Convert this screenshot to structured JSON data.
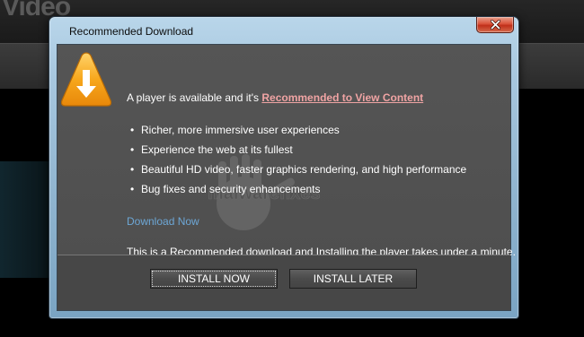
{
  "background": {
    "site_title": "Video"
  },
  "dialog": {
    "title": "Recommended Download",
    "headline_prefix": "A player is available and it's ",
    "headline_link": "Recommended to View Content",
    "features": [
      "Richer, more immersive user experiences",
      "Experience the web at its fullest",
      "Beautiful HD video, faster graphics rendering, and high performance",
      "Bug fixes and security enhancements"
    ],
    "download_link": "Download Now",
    "footnote": "This is a Recommended download and Installing the player takes under a minute.",
    "buttons": {
      "install_now": "INSTALL NOW",
      "install_later": "INSTALL LATER"
    },
    "watermark_text": "malwarefixes"
  },
  "icons": {
    "warning": "warning-download-icon",
    "close": "close-icon"
  },
  "colors": {
    "link": "#f0a4a4",
    "download_link": "#6da7d6",
    "warning_orange": "#f5a21a",
    "close_red": "#c0301a"
  }
}
